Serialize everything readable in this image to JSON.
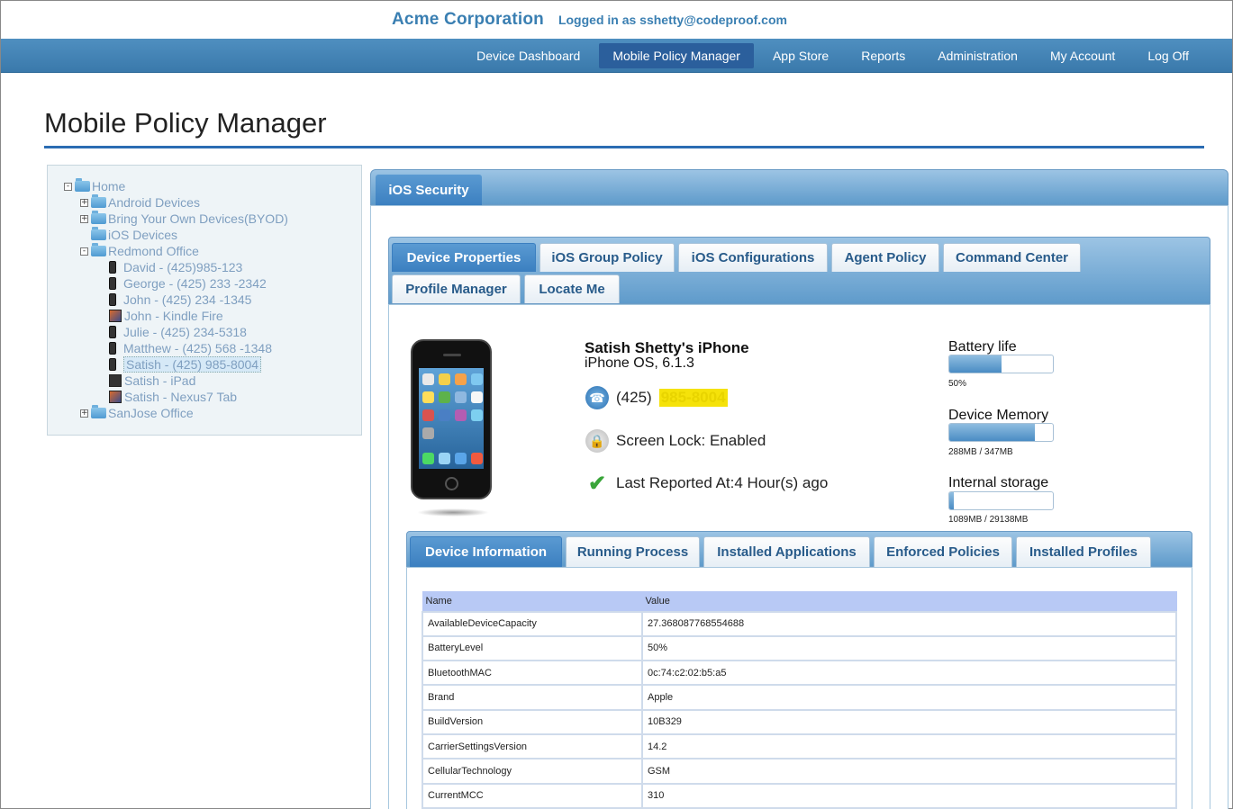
{
  "header": {
    "company": "Acme Corporation",
    "logged_in": "Logged in as sshetty@codeproof.com"
  },
  "nav": [
    {
      "label": "Device Dashboard",
      "active": false
    },
    {
      "label": "Mobile Policy Manager",
      "active": true
    },
    {
      "label": "App Store",
      "active": false
    },
    {
      "label": "Reports",
      "active": false
    },
    {
      "label": "Administration",
      "active": false
    },
    {
      "label": "My Account",
      "active": false
    },
    {
      "label": "Log Off",
      "active": false
    }
  ],
  "page_title": "Mobile Policy Manager",
  "tree": {
    "root": "Home",
    "groups": [
      {
        "label": "Android Devices",
        "expander": "+"
      },
      {
        "label": "Bring Your Own Devices(BYOD)",
        "expander": "+"
      },
      {
        "label": "iOS Devices",
        "expander": ""
      },
      {
        "label": "Redmond Office",
        "expander": "-"
      }
    ],
    "devices": [
      {
        "label": "David - (425)985-123",
        "icon": "phone-icon",
        "selected": false
      },
      {
        "label": "George - (425) 233 -2342",
        "icon": "phone-icon",
        "selected": false
      },
      {
        "label": "John - (425) 234 -1345",
        "icon": "phone-icon",
        "selected": false
      },
      {
        "label": "John - Kindle Fire",
        "icon": "tablet-icon",
        "selected": false
      },
      {
        "label": "Julie - (425) 234-5318",
        "icon": "phone-icon",
        "selected": false
      },
      {
        "label": "Matthew - (425) 568 -1348",
        "icon": "phone-icon",
        "selected": false
      },
      {
        "label": "Satish - (425) 985-8004",
        "icon": "phone-icon",
        "selected": true
      },
      {
        "label": "Satish - iPad",
        "icon": "tablet-icon",
        "selected": false
      },
      {
        "label": "Satish - Nexus7 Tab",
        "icon": "tablet-icon",
        "selected": false
      }
    ],
    "last_group": {
      "label": "SanJose Office",
      "expander": "+"
    }
  },
  "section_tab": "iOS Security",
  "tabs_top": [
    {
      "label": "Device Properties",
      "active": true
    },
    {
      "label": "iOS Group Policy",
      "active": false
    },
    {
      "label": "iOS Configurations",
      "active": false
    },
    {
      "label": "Agent Policy",
      "active": false
    },
    {
      "label": "Command Center",
      "active": false
    },
    {
      "label": "Profile Manager",
      "active": false
    },
    {
      "label": "Locate Me",
      "active": false
    }
  ],
  "device": {
    "name": "Satish Shetty's iPhone",
    "os": "iPhone OS, 6.1.3",
    "phone_prefix": "(425)",
    "phone_redacted": "985-8004",
    "screen_lock": "Screen Lock: Enabled",
    "last_reported": "Last Reported At:4 Hour(s) ago"
  },
  "meters": {
    "battery": {
      "label": "Battery life",
      "value_text": "50%",
      "fraction": 0.5
    },
    "memory": {
      "label": "Device Memory",
      "value_text": "288MB / 347MB",
      "fraction": 0.83
    },
    "storage": {
      "label": "Internal storage",
      "value_text": "1089MB / 29138MB",
      "fraction": 0.04
    }
  },
  "tabs_bottom": [
    {
      "label": "Device Information",
      "active": true
    },
    {
      "label": "Running Process",
      "active": false
    },
    {
      "label": "Installed Applications",
      "active": false
    },
    {
      "label": "Enforced Policies",
      "active": false
    },
    {
      "label": "Installed Profiles",
      "active": false
    }
  ],
  "table": {
    "headers": [
      "Name",
      "Value"
    ],
    "rows": [
      [
        "AvailableDeviceCapacity",
        "27.368087768554688"
      ],
      [
        "BatteryLevel",
        "50%"
      ],
      [
        "BluetoothMAC",
        "0c:74:c2:02:b5:a5"
      ],
      [
        "Brand",
        "Apple"
      ],
      [
        "BuildVersion",
        "10B329"
      ],
      [
        "CarrierSettingsVersion",
        "14.2"
      ],
      [
        "CellularTechnology",
        "GSM"
      ],
      [
        "CurrentMCC",
        "310"
      ]
    ]
  }
}
